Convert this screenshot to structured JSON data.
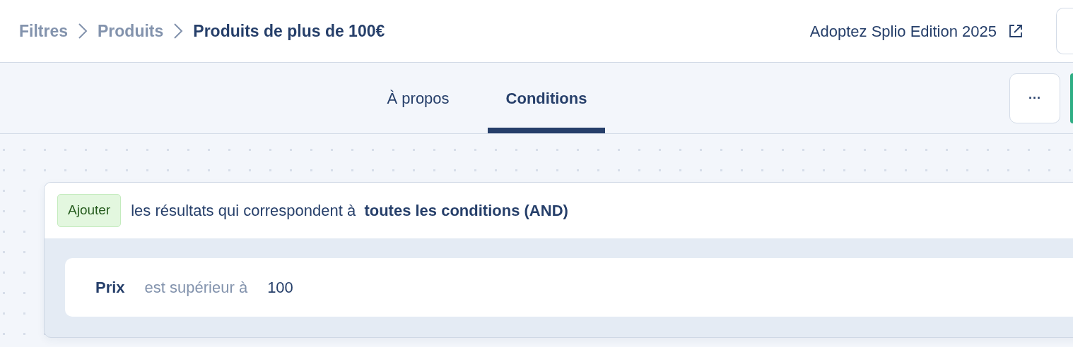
{
  "breadcrumbs": [
    {
      "label": "Filtres",
      "current": false
    },
    {
      "label": "Produits",
      "current": false
    },
    {
      "label": "Produits de plus de 100€",
      "current": true
    }
  ],
  "header_link": {
    "label": "Adoptez Splio Edition 2025"
  },
  "tabs": [
    {
      "label": "À propos",
      "selected": false
    },
    {
      "label": "Conditions",
      "selected": true
    }
  ],
  "more_button": {
    "label": "···"
  },
  "group": {
    "action": "Ajouter",
    "sentence": "les résultats qui correspondent à  **toutes les conditions (AND)**",
    "conditions": [
      {
        "field": "Prix",
        "operator": "est supérieur à",
        "value": "100"
      }
    ]
  }
}
